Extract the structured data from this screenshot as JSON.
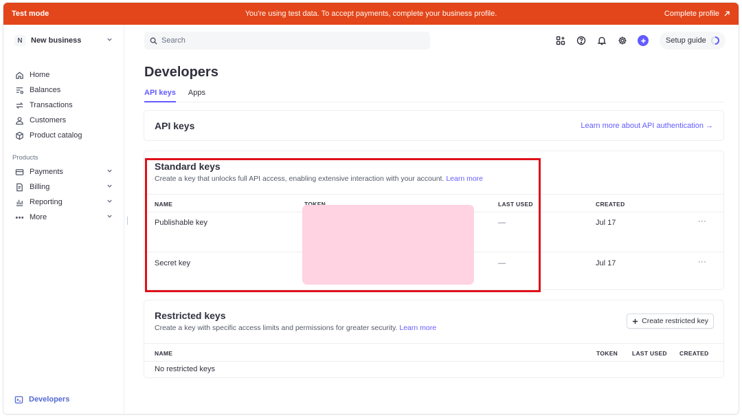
{
  "banner": {
    "mode": "Test mode",
    "message": "You're using test data. To accept payments, complete your business profile.",
    "complete_profile": "Complete profile"
  },
  "business": {
    "initial": "N",
    "name": "New business"
  },
  "sidebar": {
    "items": [
      {
        "label": "Home",
        "icon": "home-icon"
      },
      {
        "label": "Balances",
        "icon": "balances-icon"
      },
      {
        "label": "Transactions",
        "icon": "transactions-icon"
      },
      {
        "label": "Customers",
        "icon": "customers-icon"
      },
      {
        "label": "Product catalog",
        "icon": "product-catalog-icon"
      }
    ],
    "products_label": "Products",
    "products": [
      {
        "label": "Payments",
        "icon": "payments-icon"
      },
      {
        "label": "Billing",
        "icon": "billing-icon"
      },
      {
        "label": "Reporting",
        "icon": "reporting-icon"
      },
      {
        "label": "More",
        "icon": "more-icon"
      }
    ],
    "developers": "Developers"
  },
  "topbar": {
    "search_placeholder": "Search",
    "setup_guide": "Setup guide"
  },
  "page": {
    "title": "Developers",
    "tabs": [
      {
        "label": "API keys",
        "active": true
      },
      {
        "label": "Apps",
        "active": false
      }
    ]
  },
  "api_keys_card": {
    "title": "API keys",
    "learn_link": "Learn more about API authentication →"
  },
  "standard_keys": {
    "title": "Standard keys",
    "description": "Create a key that unlocks full API access, enabling extensive interaction with your account.",
    "learn_more": "Learn more",
    "columns": [
      "NAME",
      "TOKEN",
      "LAST USED",
      "CREATED"
    ],
    "rows": [
      {
        "name": "Publishable key",
        "last_used": "—",
        "created": "Jul 17",
        "menu": "···"
      },
      {
        "name": "Secret key",
        "last_used": "—",
        "created": "Jul 17",
        "menu": "···"
      }
    ]
  },
  "restricted_keys": {
    "title": "Restricted keys",
    "description": "Create a key with specific access limits and permissions for greater security.",
    "learn_more": "Learn more",
    "create_button": "Create restricted key",
    "columns": [
      "NAME",
      "TOKEN",
      "LAST USED",
      "CREATED"
    ],
    "empty": "No restricted keys"
  },
  "colors": {
    "banner": "#e3461a",
    "accent": "#635bff",
    "highlight": "#e0101a",
    "redaction": "#ffd3e1"
  }
}
